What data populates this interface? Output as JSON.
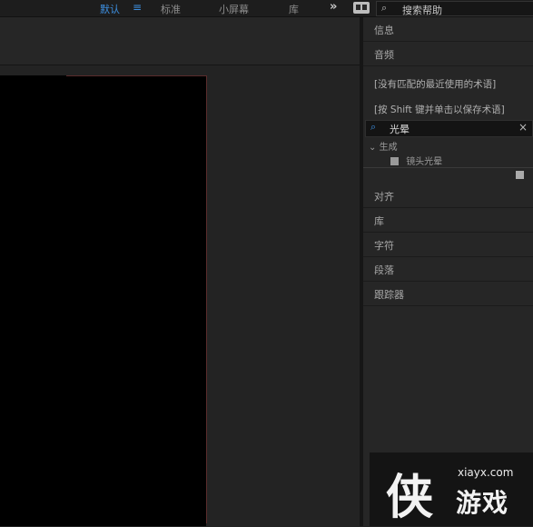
{
  "workspaces": {
    "default": "默认",
    "menu_icon": "hamburger-icon",
    "standard": "标准",
    "small_screen": "小屏幕",
    "library": "库",
    "more": "»"
  },
  "help_search": {
    "icon": "search-icon",
    "text": "搜索帮助"
  },
  "right_panels": {
    "info": "信息",
    "audio": "音频",
    "effects": {
      "hint_recent": "[没有匹配的最近使用的术语]",
      "hint_shift": "[按 Shift 键并单击以保存术语]",
      "search_value": "光晕",
      "clear": "×",
      "category": "生成",
      "item": "镜头光晕"
    },
    "align": "对齐",
    "libraries": "库",
    "character": "字符",
    "paragraph": "段落",
    "tracker": "跟踪器"
  },
  "watermark": {
    "url": "xiayx.com",
    "big1": "侠",
    "big2": "游戏"
  },
  "colors": {
    "accent": "#3d8fe0",
    "bg": "#232323",
    "panel": "#262626"
  }
}
